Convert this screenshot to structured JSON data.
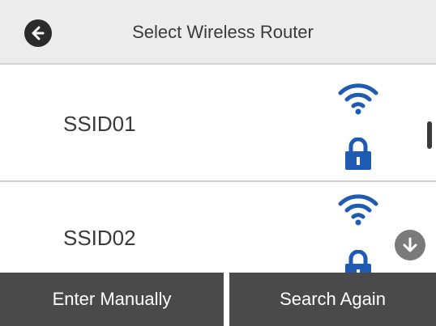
{
  "header": {
    "title": "Select Wireless Router",
    "back_icon": "arrow-left-circle-icon"
  },
  "networks": [
    {
      "ssid": "SSID01",
      "signal_icon": "wifi-icon",
      "security_icon": "lock-icon"
    },
    {
      "ssid": "SSID02",
      "signal_icon": "wifi-icon",
      "security_icon": "lock-icon"
    }
  ],
  "scroll": {
    "down_icon": "arrow-down-circle-icon"
  },
  "footer": {
    "enter_manually_label": "Enter Manually",
    "search_again_label": "Search Again"
  },
  "colors": {
    "icon_blue": "#1f5ab3",
    "header_bg": "#ececec",
    "footer_button_bg": "#4a4a4a"
  }
}
